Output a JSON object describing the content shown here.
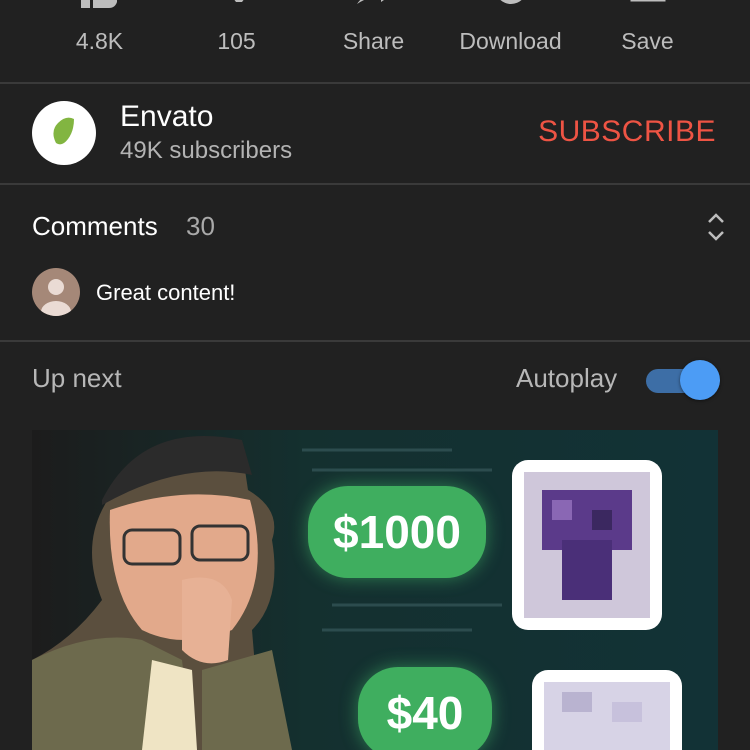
{
  "actions": [
    {
      "label": "4.8K",
      "icon": "thumbs-up-icon"
    },
    {
      "label": "105",
      "icon": "thumbs-down-icon"
    },
    {
      "label": "Share",
      "icon": "share-icon"
    },
    {
      "label": "Download",
      "icon": "download-icon"
    },
    {
      "label": "Save",
      "icon": "save-icon"
    }
  ],
  "channel": {
    "name": "Envato",
    "subscribers": "49K subscribers",
    "subscribe_label": "SUBSCRIBE"
  },
  "comments": {
    "title": "Comments",
    "count": "30",
    "preview": "Great content!"
  },
  "upnext": {
    "title": "Up next",
    "autoplay_label": "Autoplay",
    "autoplay_on": true
  },
  "thumbnail": {
    "price_top": "$1000",
    "price_bottom": "$40"
  },
  "colors": {
    "background": "#212121",
    "subscribe": "#ee5444",
    "toggle_accent": "#4c9cf5",
    "envato_green": "#82b541",
    "price_green": "#3fae5f"
  }
}
